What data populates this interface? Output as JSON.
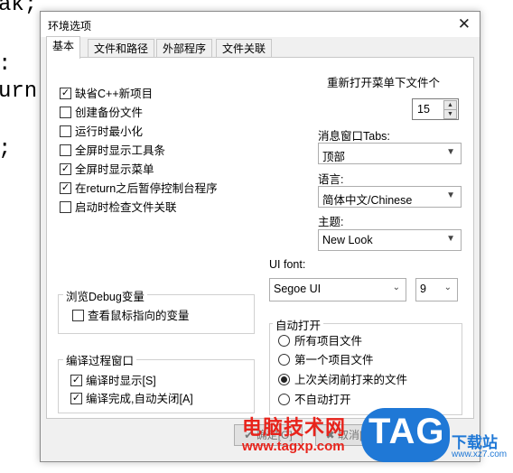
{
  "background_code": [
    "ak;",
    ":",
    "urn",
    ";"
  ],
  "dialog": {
    "title": "环境选项",
    "close_glyph": "✕",
    "tabs": [
      "基本",
      "文件和路径",
      "外部程序",
      "文件关联"
    ],
    "options": [
      {
        "label": "缺省C++新项目",
        "checked": true
      },
      {
        "label": "创建备份文件",
        "checked": false
      },
      {
        "label": "运行时最小化",
        "checked": false
      },
      {
        "label": "全屏时显示工具条",
        "checked": false
      },
      {
        "label": "全屏时显示菜单",
        "checked": true
      },
      {
        "label": "在return之后暂停控制台程序",
        "checked": true
      },
      {
        "label": "启动时检查文件关联",
        "checked": false
      }
    ],
    "reopen_label": "重新打开菜单下文件个",
    "reopen_value": "15",
    "tabs_label": "消息窗口Tabs:",
    "tabs_value": "顶部",
    "language_label": "语言:",
    "language_value": "简体中文/Chinese",
    "theme_label": "主题:",
    "theme_value": "New Look",
    "uifont_label": "UI font:",
    "uifont_value": "Segoe UI",
    "uifont_size": "9",
    "debug_group": {
      "title": "浏览Debug变量",
      "option": {
        "label": "查看鼠标指向的变量",
        "checked": false
      }
    },
    "compile_group": {
      "title": "编译过程窗口",
      "options": [
        {
          "label": "编译时显示[S]",
          "checked": true
        },
        {
          "label": "编译完成,自动关闭[A]",
          "checked": true
        }
      ]
    },
    "autoopen_group": {
      "title": "自动打开",
      "options": [
        {
          "label": "所有项目文件",
          "selected": false
        },
        {
          "label": "第一个项目文件",
          "selected": false
        },
        {
          "label": "上次关闭前打来的文件",
          "selected": true
        },
        {
          "label": "不自动打开",
          "selected": false
        }
      ]
    },
    "buttons": {
      "ok": "✔ 确定[O]",
      "cancel": "✖ 取消[C]"
    }
  },
  "watermark": {
    "site_name": "电脑技术网",
    "url": "www.tagxp.com",
    "tag_logo": "TAG",
    "site2_name": "下载站",
    "site2_url": "www.xz7.com",
    "colors": {
      "red": "#e8231b",
      "blue": "#1f78d6"
    }
  }
}
